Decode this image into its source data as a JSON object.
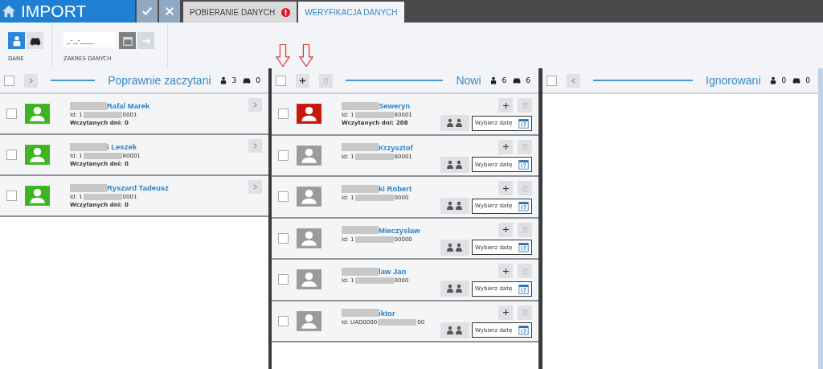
{
  "header": {
    "title": "IMPORT"
  },
  "tabs": [
    {
      "label": "POBIERANIE DANYCH",
      "selected": false,
      "error": true
    },
    {
      "label": "WERYFIKACJA DANYCH",
      "selected": true,
      "error": false
    }
  ],
  "toolbar": {
    "data_group": {
      "label": "DANE",
      "options": [
        {
          "kind": "person",
          "selected": true
        },
        {
          "kind": "car",
          "selected": false
        }
      ]
    },
    "range_group": {
      "label": "ZAKRES DANYCH",
      "placeholder": "_-_-___"
    }
  },
  "columns": [
    {
      "title": "Poprawnie zaczytani",
      "persons": "3",
      "cars": "0",
      "kind": "accepted",
      "checked": false,
      "rows": [
        {
          "name": "Rafal Marek",
          "id_start": "Id: 1",
          "id_end": "0001",
          "days_label": "Wczytanych dni:",
          "days": "0",
          "color": "#3cb521",
          "checked": false
        },
        {
          "name": "i Leszek",
          "id_start": "Id: 1",
          "id_end": "80001",
          "days_label": "Wczytanych dni:",
          "days": "0",
          "color": "#3cb521",
          "checked": false
        },
        {
          "name": "Ryszard Tadeusz",
          "id_start": "Id: 1",
          "id_end": "0001",
          "days_label": "Wczytanych dni:",
          "days": "0",
          "color": "#3cb521",
          "checked": false
        }
      ]
    },
    {
      "title": "Nowi",
      "persons": "6",
      "cars": "6",
      "kind": "new",
      "checked": false,
      "rows": [
        {
          "name": "Seweryn",
          "id_start": "Id: 1",
          "id_end": "80001",
          "days_label": "Wczytanych dni:",
          "days": "208",
          "color": "#c8160e",
          "checked": false,
          "date_placeholder": "Wybierz datę"
        },
        {
          "name": "Krzysztof",
          "id_start": "Id: 1",
          "id_end": "80001",
          "color": "#9b9b9b",
          "checked": false,
          "date_placeholder": "Wybierz datę"
        },
        {
          "name": "ki Robert",
          "id_start": "Id: 1",
          "id_end": "0000",
          "color": "#9b9b9b",
          "checked": false,
          "date_placeholder": "Wybierz datę"
        },
        {
          "name": "Mieczyslaw",
          "id_start": "Id: 1",
          "id_end": "00000",
          "color": "#9b9b9b",
          "checked": false,
          "date_placeholder": "Wybierz datę"
        },
        {
          "name": "law Jan",
          "id_start": "Id: 1",
          "id_end": "0000",
          "color": "#9b9b9b",
          "checked": false,
          "date_placeholder": "Wybierz datę"
        },
        {
          "name": "iktor",
          "id_start": "Id: UAD0000",
          "id_end": "00",
          "color": "#9b9b9b",
          "checked": false,
          "date_placeholder": "Wybierz datę"
        }
      ]
    },
    {
      "title": "Ignorowani",
      "persons": "0",
      "cars": "0",
      "kind": "ignored",
      "checked": false
    }
  ]
}
